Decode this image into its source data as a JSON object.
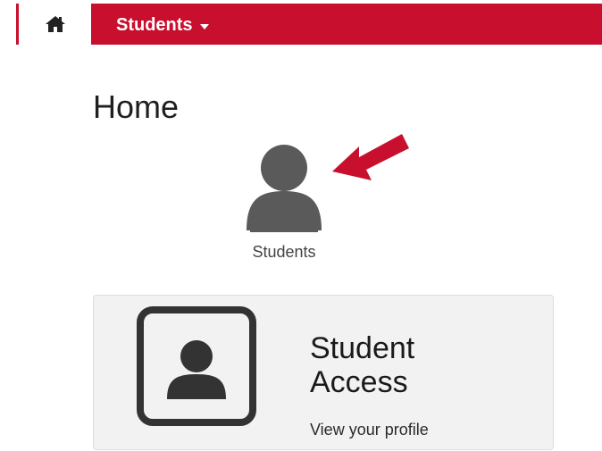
{
  "nav": {
    "home_icon": "home-icon",
    "students_menu_label": "Students",
    "students_menu_icon": "caret-down-icon",
    "accent_color": "#c8102e"
  },
  "page": {
    "title": "Home"
  },
  "students_tile": {
    "icon": "user-icon",
    "label": "Students"
  },
  "annotation": {
    "icon": "red-arrow-icon",
    "color": "#c8102e"
  },
  "student_access_card": {
    "icon": "user-icon",
    "title_line1": "Student",
    "title_line2": "Access",
    "subtitle": "View your profile"
  }
}
